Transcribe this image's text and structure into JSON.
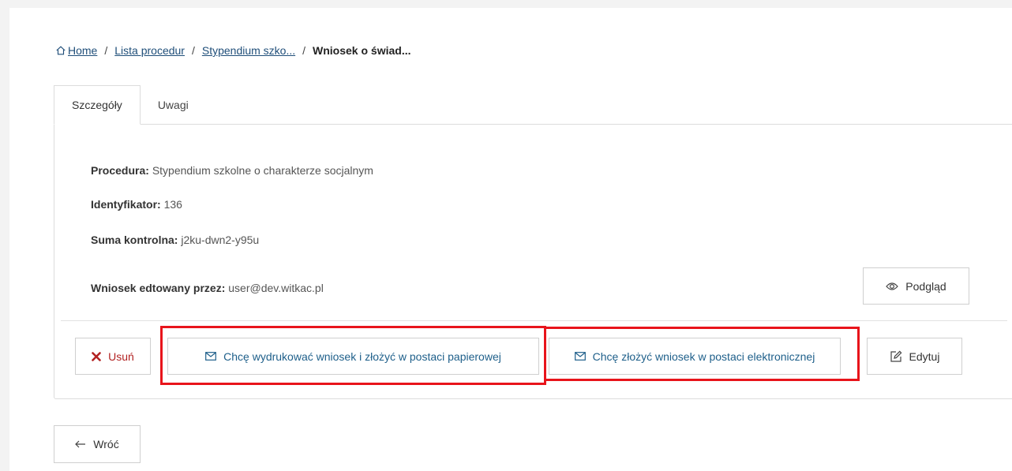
{
  "breadcrumb": {
    "home_label": "Home",
    "items": [
      "Lista procedur",
      "Stypendium szko...",
      "Wniosek o świad..."
    ],
    "separator": "/"
  },
  "tabs": [
    {
      "label": "Szczegóły",
      "active": true
    },
    {
      "label": "Uwagi",
      "active": false
    }
  ],
  "details": {
    "procedure_label": "Procedura:",
    "procedure_value": "Stypendium szkolne o charakterze socjalnym",
    "identifier_label": "Identyfikator:",
    "identifier_value": "136",
    "checksum_label": "Suma kontrolna:",
    "checksum_value": "j2ku-dwn2-y95u",
    "edited_by_label": "Wniosek edtowany przez:",
    "edited_by_value": "user@dev.witkac.pl"
  },
  "actions": {
    "preview_label": "Podgląd",
    "delete_label": "Usuń",
    "paper_label": "Chcę wydrukować wniosek i złożyć w postaci papierowej",
    "electronic_label": "Chcę złożyć wniosek w postaci elektronicznej",
    "edit_label": "Edytuj",
    "back_label": "Wróć"
  },
  "icons": {
    "home": "home-icon",
    "preview": "eye-icon",
    "delete": "x-icon",
    "mail": "envelope-icon",
    "edit": "pencil-icon",
    "back": "arrow-left-icon"
  },
  "colors": {
    "link": "#1f4e79",
    "action_text": "#1e5f8a",
    "delete": "#b22222",
    "highlight": "#e8141b"
  }
}
